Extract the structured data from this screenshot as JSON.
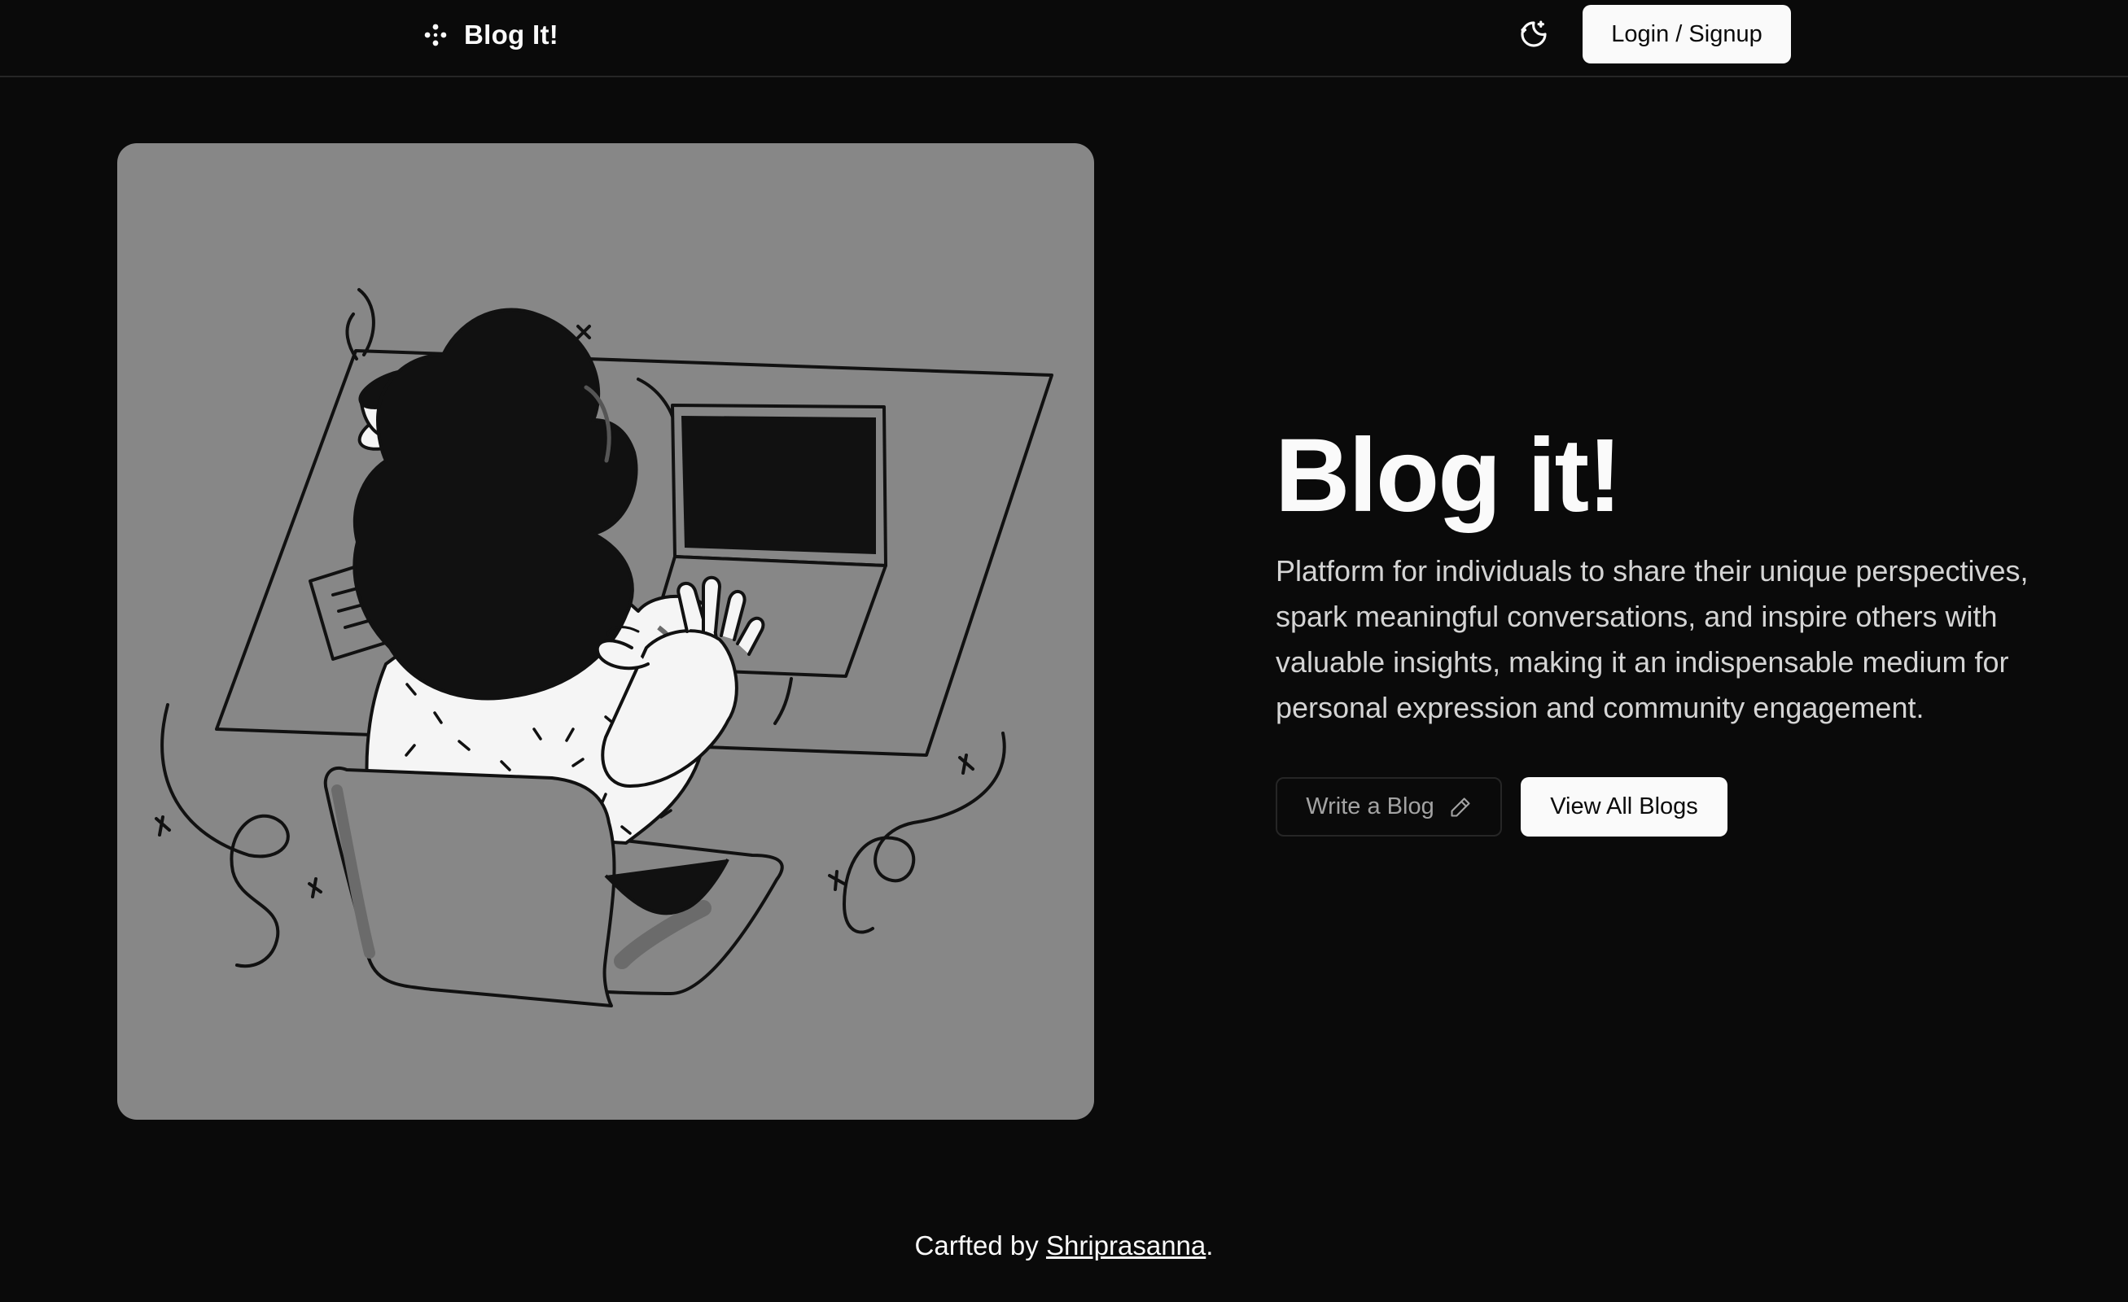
{
  "header": {
    "brand": "Blog It!",
    "brand_icon": "sparkle-icon",
    "theme_toggle_icon": "moon-stars-icon",
    "login_label": "Login / Signup"
  },
  "hero": {
    "illustration": "person-typing-on-laptop-illustration",
    "title": "Blog it!",
    "description": "Platform for individuals to share their unique perspectives, spark meaningful conversations, and inspire others with valuable insights, making it an indispensable medium for personal expression and community engagement.",
    "write_label": "Write a Blog",
    "write_icon": "pencil-icon",
    "view_label": "View All Blogs"
  },
  "footer": {
    "prefix": "Carfted by ",
    "author": "Shriprasanna",
    "suffix": "."
  },
  "colors": {
    "background": "#0a0a0a",
    "image_panel": "#878787",
    "primary_button": "#fafafa",
    "muted_text": "#d4d4d4"
  }
}
